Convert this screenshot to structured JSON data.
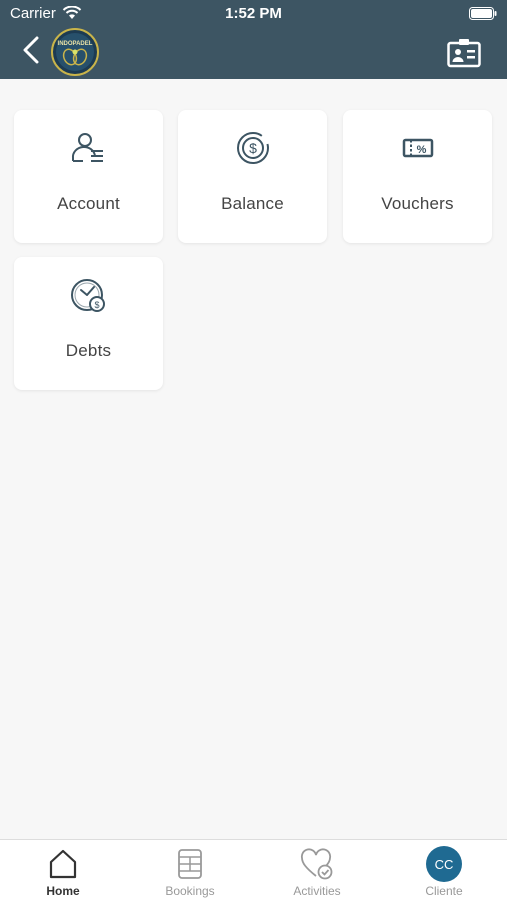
{
  "status_bar": {
    "carrier": "Carrier",
    "time": "1:52 PM"
  },
  "header": {
    "back_icon": "chevron-left-icon",
    "logo_text": "INDOPADEL",
    "id_card_icon": "id-card-icon",
    "background": "#3d5563"
  },
  "menu": {
    "items": [
      {
        "label": "Account",
        "icon": "user-list-icon"
      },
      {
        "label": "Balance",
        "icon": "dollar-coin-icon"
      },
      {
        "label": "Vouchers",
        "icon": "voucher-percent-icon"
      },
      {
        "label": "Debts",
        "icon": "clock-dollar-icon"
      }
    ]
  },
  "tabbar": {
    "items": [
      {
        "label": "Home",
        "icon": "home-icon",
        "active": true
      },
      {
        "label": "Bookings",
        "icon": "court-icon",
        "active": false
      },
      {
        "label": "Activities",
        "icon": "heart-check-icon",
        "active": false
      },
      {
        "label": "Cliente",
        "avatar_initials": "CC",
        "active": false
      }
    ],
    "avatar_color": "#1f6a92"
  }
}
